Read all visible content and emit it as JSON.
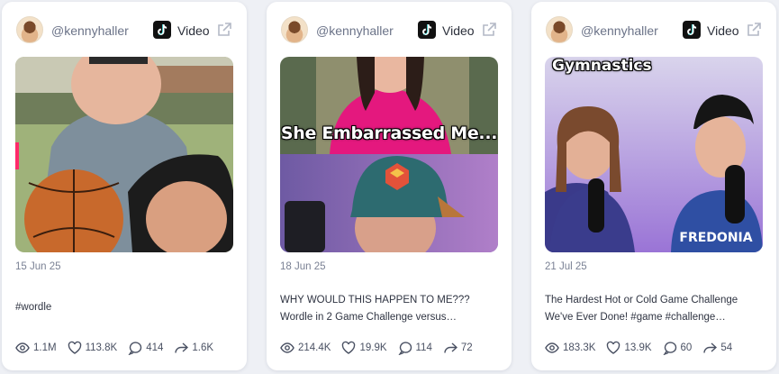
{
  "colors": {
    "card_bg": "#ffffff",
    "page_bg": "#eef0f5",
    "muted_text": "#6b7388"
  },
  "icons": {
    "avatar": "avatar-icon",
    "platform": "tiktok-icon",
    "open": "external-link-icon",
    "views": "eye-icon",
    "likes": "heart-icon",
    "comments": "comment-icon",
    "shares": "share-icon"
  },
  "cards": [
    {
      "handle": "@kennyhaller",
      "platform": "Video",
      "date": "15 Jun 25",
      "caption": "#wordle",
      "thumbnail_overlay": "",
      "stats": {
        "views": "1.1M",
        "likes": "113.8K",
        "comments": "414",
        "shares": "1.6K"
      }
    },
    {
      "handle": "@kennyhaller",
      "platform": "Video",
      "date": "18 Jun 25",
      "caption": "WHY WOULD THIS HAPPEN TO ME??? Wordle in 2 Game Challenge versus…",
      "thumbnail_overlay": "She Embarrassed Me...",
      "stats": {
        "views": "214.4K",
        "likes": "19.9K",
        "comments": "114",
        "shares": "72"
      }
    },
    {
      "handle": "@kennyhaller",
      "platform": "Video",
      "date": "21 Jul 25",
      "caption": "The Hardest Hot or Cold Game Challenge We've Ever Done! #game #challenge…",
      "thumbnail_overlay": "Gymnastics",
      "stats": {
        "views": "183.3K",
        "likes": "13.9K",
        "comments": "60",
        "shares": "54"
      }
    }
  ]
}
